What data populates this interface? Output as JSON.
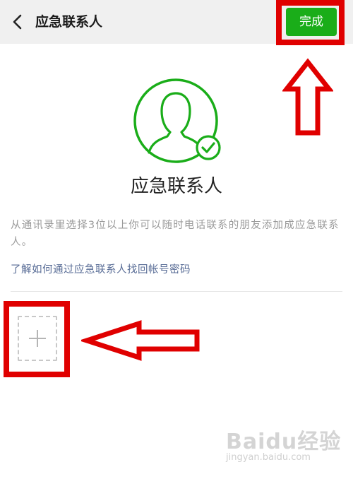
{
  "header": {
    "title": "应急联系人",
    "done_label": "完成"
  },
  "main": {
    "heading": "应急联系人",
    "description": "从通讯录里选择3位以上你可以随时电话联系的朋友添加成应急联系人。",
    "link_text": "了解如何通过应急联系人找回帐号密码"
  },
  "colors": {
    "accent_green": "#1aad19",
    "link_blue": "#576b95",
    "annotation_red": "#e00000"
  },
  "icons": {
    "back": "chevron-left-icon",
    "avatar": "person-avatar-icon",
    "check": "check-circle-icon",
    "add": "plus-icon"
  },
  "watermark": {
    "logo": "Baidu经验",
    "url": "jingyan.baidu.com"
  }
}
